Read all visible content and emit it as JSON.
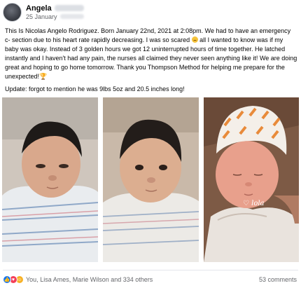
{
  "post": {
    "author": "Angela",
    "timestamp": "25 January",
    "paragraphs": [
      "This Is Nicolas Angelo Rodriguez. Born January 22nd, 2021 at 2:08pm. We had to have an emergency c- section due to his heart rate rapidly decreasing. I was so scared",
      "all I wanted to know was if my baby was okay. Instead of 3 golden hours we got 12 uninterrupted hours of time together. He latched instantly and I haven't had any pain, the nurses all claimed they never seen anything like it! We are doing great and hoping to go home tomorrow. Thank you Thompson Method for helping me prepare for the unexpected!",
      "Update: forgot to mention he was 9lbs 5oz and 20.5 inches long!"
    ],
    "emojis": {
      "scared": "worried-face-emoji",
      "trophy": "🏆"
    },
    "photos": [
      {
        "name": "newborn-photo-swaddled"
      },
      {
        "name": "newborn-photo-closeup"
      },
      {
        "name": "newborn-photo-hat"
      }
    ],
    "photo3_watermark": "♡ lola"
  },
  "engagement": {
    "reaction_icons": [
      "like-icon",
      "love-icon",
      "care-icon"
    ],
    "reactors": "You, Lisa Ames, Marie Wilson and 334 others",
    "comments": "53 comments"
  },
  "colors": {
    "like": "#1877f2",
    "love": "#f33e58",
    "care": "#f7b125",
    "secondary_text": "#65676b"
  }
}
